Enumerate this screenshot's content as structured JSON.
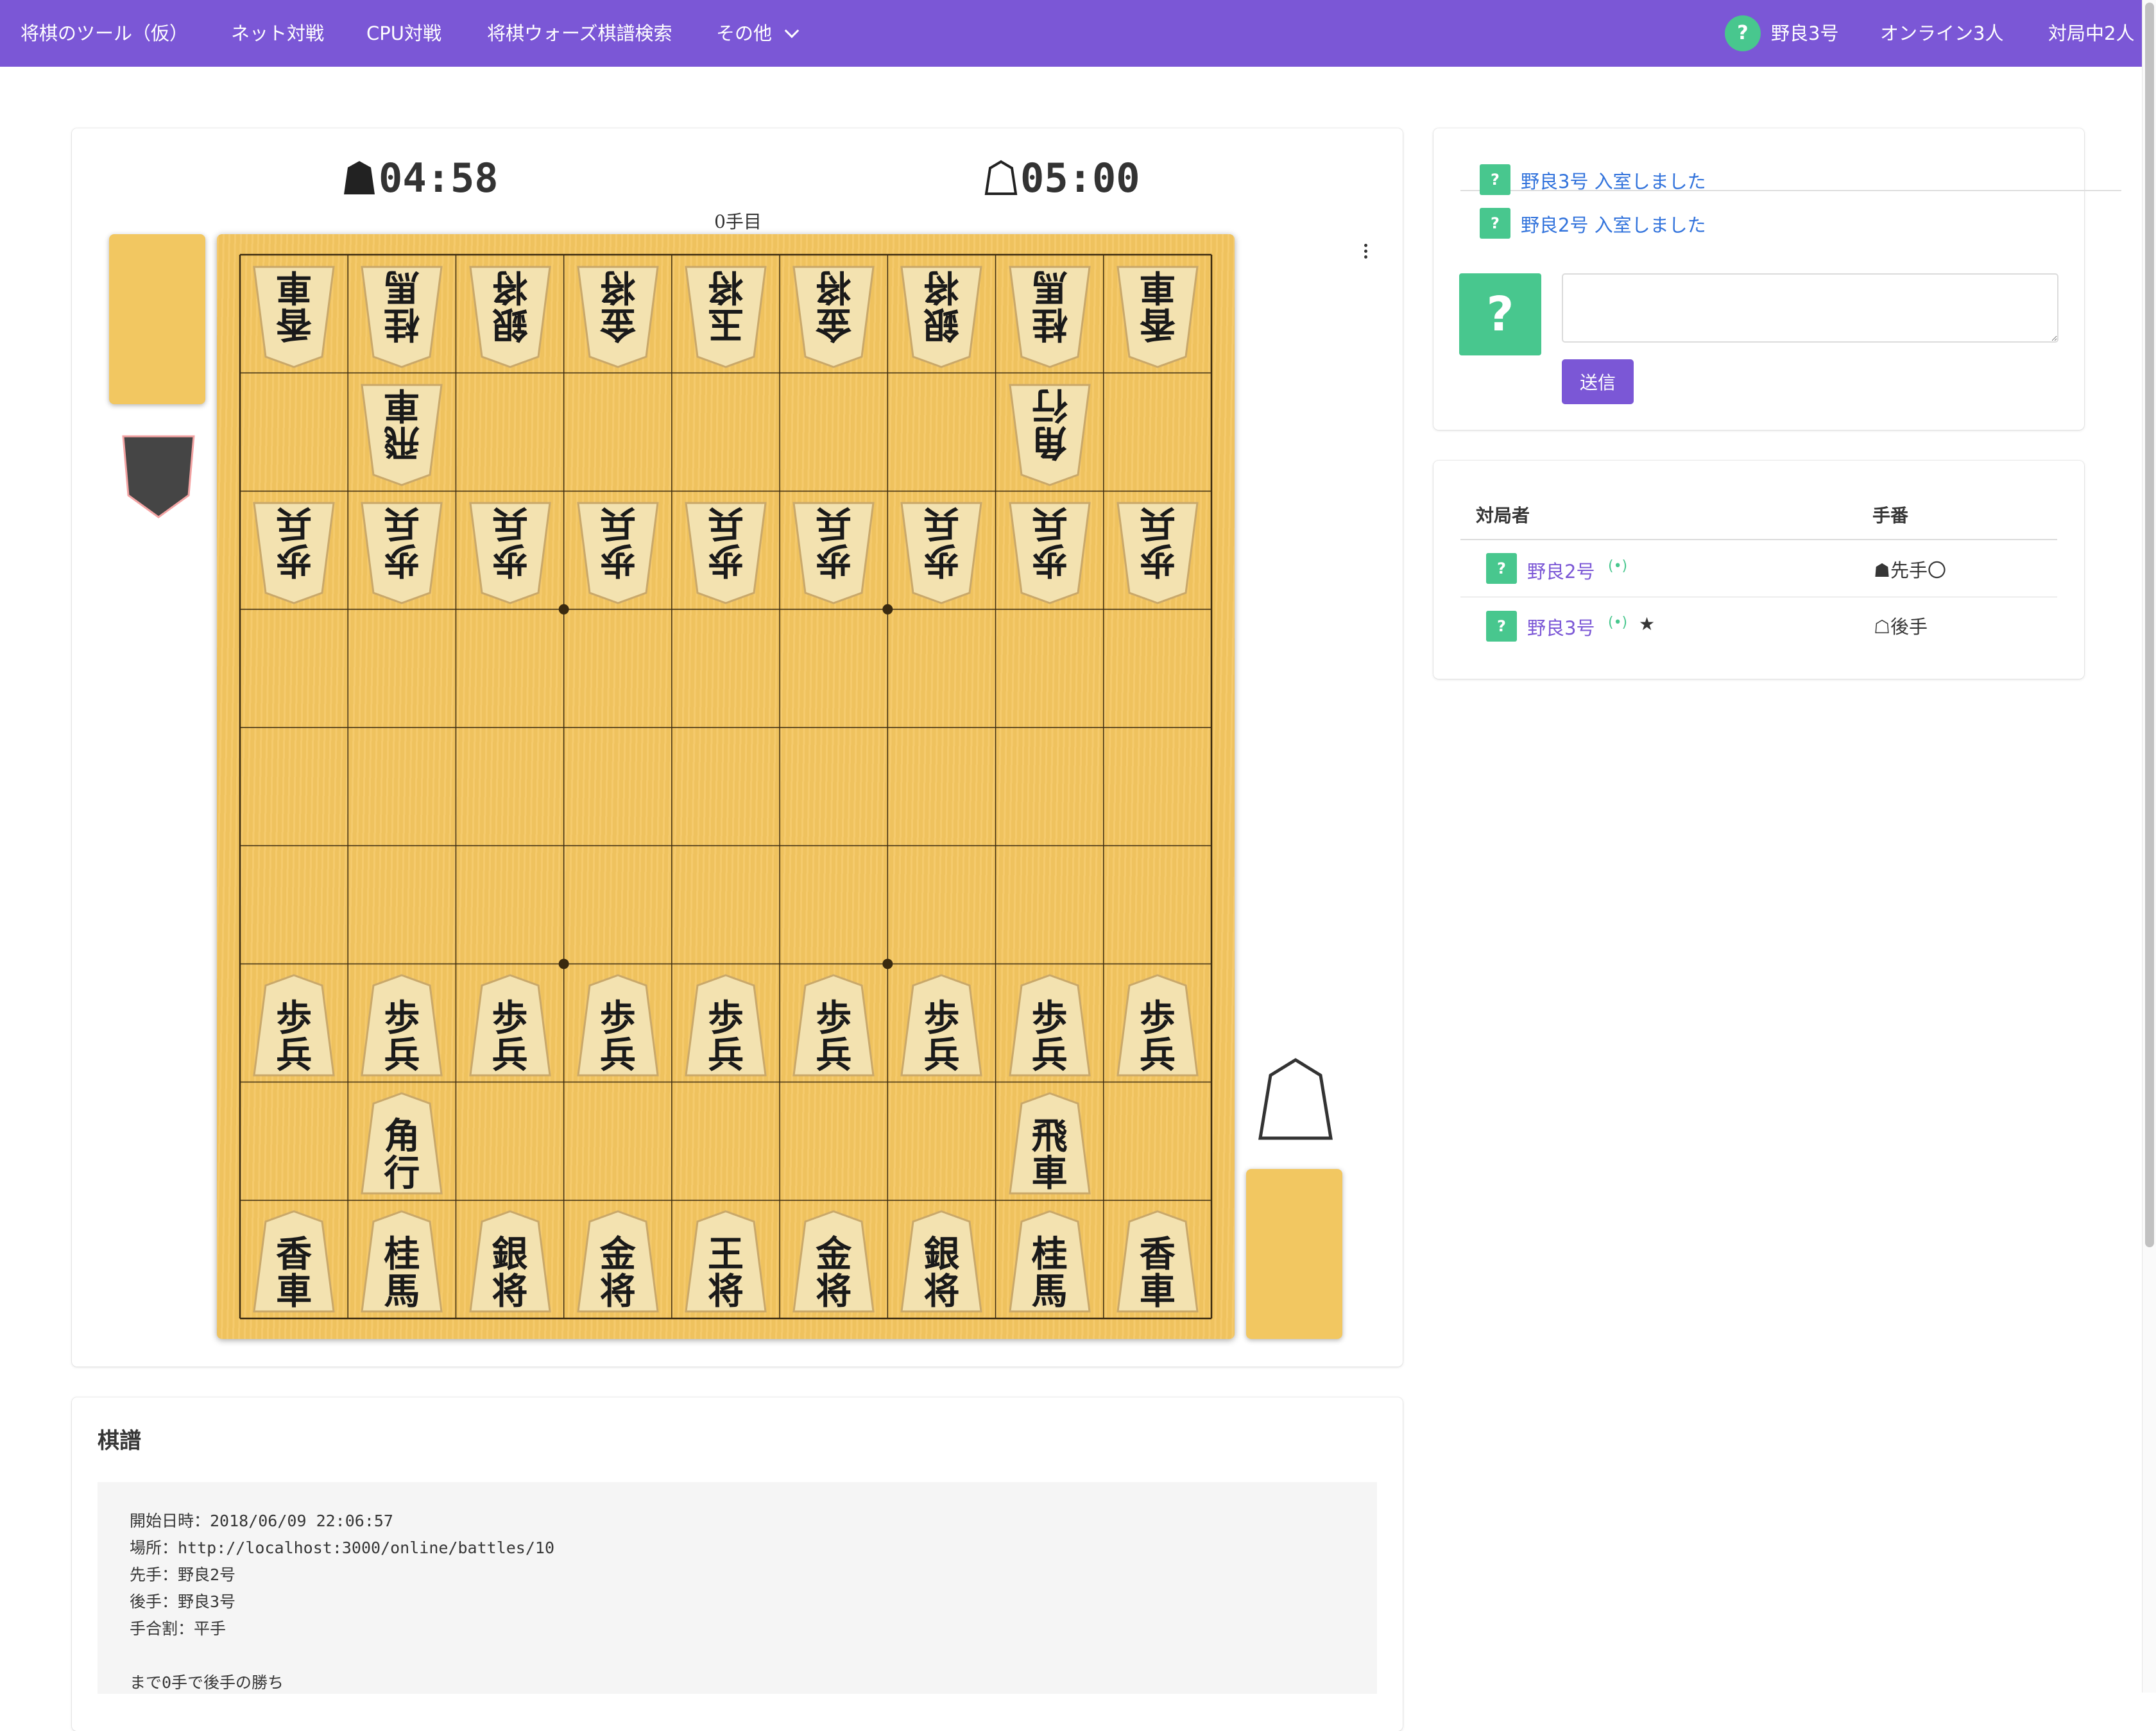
{
  "nav": {
    "brand": "将棋のツール（仮）",
    "items": [
      "ネット対戦",
      "CPU対戦",
      "将棋ウォーズ棋譜検索",
      "その他"
    ],
    "user_avatar": "?",
    "user_name": "野良3号",
    "online": "オンライン3人",
    "playing": "対局中2人"
  },
  "clocks": {
    "sente": "04:58",
    "gote": "05:00"
  },
  "move_count": "0手目",
  "board": {
    "gote_back": [
      "香車",
      "桂馬",
      "銀将",
      "金将",
      "玉将",
      "金将",
      "銀将",
      "桂馬",
      "香車"
    ],
    "gote_rook": "飛車",
    "gote_bishop": "角行",
    "pawn": "歩兵",
    "sente_rook": "飛車",
    "sente_bishop": "角行",
    "sente_back": [
      "香車",
      "桂馬",
      "銀将",
      "金将",
      "王将",
      "金将",
      "銀将",
      "桂馬",
      "香車"
    ]
  },
  "chat": {
    "messages": [
      "野良3号 入室しました",
      "野良2号 入室しました"
    ],
    "avatar": "?",
    "send_label": "送信"
  },
  "players": {
    "headers": [
      "対局者",
      "手番"
    ],
    "rows": [
      {
        "avatar": "?",
        "name": "野良2号",
        "signal": "(•)",
        "star": "",
        "turn": "☗先手〇"
      },
      {
        "avatar": "?",
        "name": "野良3号",
        "signal": "(•)",
        "star": "★",
        "turn": "☖後手"
      }
    ]
  },
  "kifu": {
    "title": "棋譜",
    "lines": [
      "開始日時：2018/06/09 22:06:57",
      "場所：http://localhost:3000/online/battles/10",
      "先手：野良2号",
      "後手：野良3号",
      "手合割：平手",
      "",
      "まで0手で後手の勝ち"
    ]
  },
  "colors": {
    "accent": "#7b57d6",
    "avatar": "#48c78e",
    "board": "#f4c660",
    "link": "#3273dc"
  }
}
